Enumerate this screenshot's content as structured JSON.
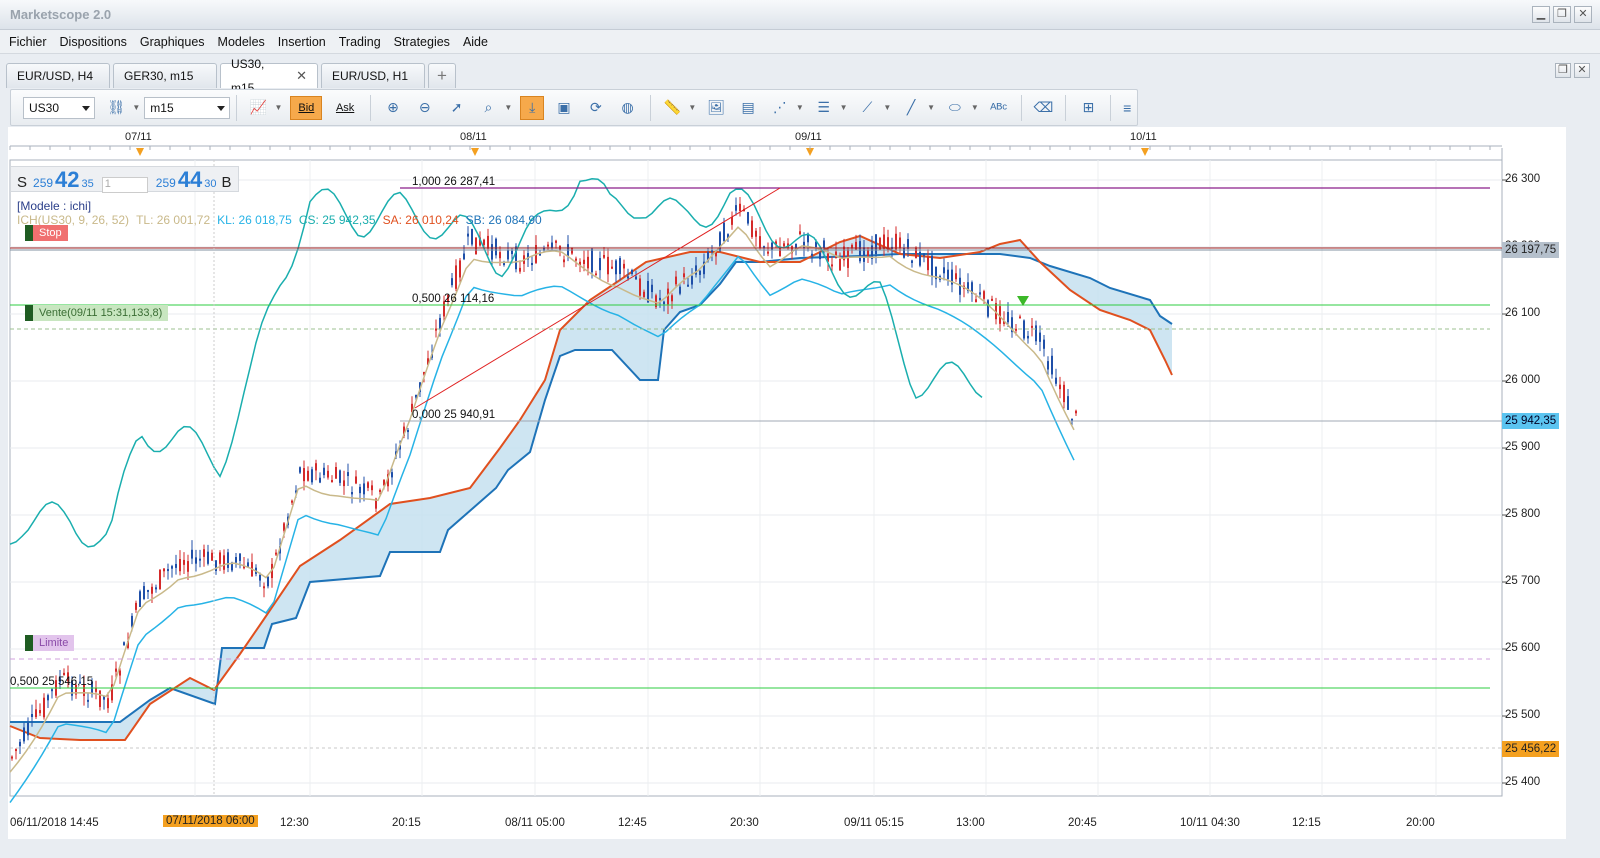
{
  "window": {
    "title": "Marketscope 2.0",
    "minimize": "▁",
    "maximize": "❐",
    "close": "✕"
  },
  "menu": [
    "Fichier",
    "Dispositions",
    "Graphiques",
    "Modeles",
    "Insertion",
    "Trading",
    "Strategies",
    "Aide"
  ],
  "tabs": [
    {
      "label": "EUR/USD, H4",
      "active": false
    },
    {
      "label": "GER30, m15",
      "active": false
    },
    {
      "label": "US30, m15",
      "active": true,
      "close": "✕"
    },
    {
      "label": "EUR/USD, H1",
      "active": false
    }
  ],
  "tab_add": "+",
  "toolbar": {
    "symbol": "US30",
    "timeframe": "m15",
    "bid": "Bid",
    "ask": "Ask"
  },
  "price": {
    "sell_label": "S",
    "sell_small": "259",
    "sell_big": "42",
    "sell_sup": "35",
    "qty": "1",
    "buy_small": "259",
    "buy_big": "44",
    "buy_sup": "30",
    "buy_label": "B"
  },
  "indicator": {
    "model": "[Modele : ichi]",
    "ich": "ICH(US30, 9, 26, 52)",
    "tl": "TL: 26 001,72",
    "kl": "KL: 26 018,75",
    "cs": "CS: 25 942,35",
    "sa": "SA: 26 010,24",
    "sb": "SB: 26 084,90"
  },
  "fib": {
    "top": "1,000 26 287,41",
    "mid": "0,500 26 114,16",
    "low": "0,000 25 940,91",
    "left": "0,500 25 546,15"
  },
  "orders": {
    "stop": "Stop",
    "sell": "Vente(09/11 15:31,133,8)",
    "limit": "Limite"
  },
  "y_axis": {
    "labels": [
      {
        "v": 26300,
        "t": "26 300"
      },
      {
        "v": 26200,
        "t": "26 200"
      },
      {
        "v": 26100,
        "t": "26 100"
      },
      {
        "v": 26000,
        "t": "26 000"
      },
      {
        "v": 25900,
        "t": "25 900"
      },
      {
        "v": 25800,
        "t": "25 800"
      },
      {
        "v": 25700,
        "t": "25 700"
      },
      {
        "v": 25600,
        "t": "25 600"
      },
      {
        "v": 25500,
        "t": "25 500"
      },
      {
        "v": 25400,
        "t": "25 400"
      }
    ],
    "stop_marker": "26 197,75",
    "price_marker": "25 942,35",
    "limit_marker": "25 456,22"
  },
  "x_axis": [
    "06/11/2018 14:45",
    "07/11/2018 06:00",
    "12:30",
    "20:15",
    "08/11 05:00",
    "12:45",
    "20:30",
    "09/11 05:15",
    "13:00",
    "20:45",
    "10/11 04:30",
    "12:15",
    "20:00"
  ],
  "top_dates": [
    "07/11",
    "08/11",
    "09/11",
    "10/11"
  ],
  "colors": {
    "tenkan": "#c9b98a",
    "kijun": "#27b3e6",
    "chikou": "#1aaeae",
    "senkou_a": "#e0501f",
    "senkou_b": "#1e73b8",
    "cloud_bull": "#c6e0f0",
    "cloud_bear": "#f6cfc0",
    "bull": "#1f4fa8",
    "bear": "#d42a2a",
    "fib": "#8a1e8a",
    "green": "#2ecc40"
  }
}
